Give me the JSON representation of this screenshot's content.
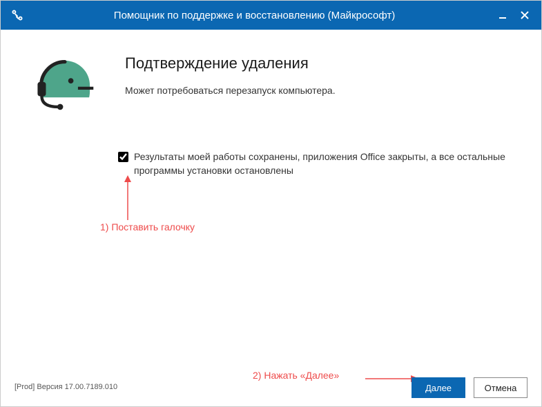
{
  "titlebar": {
    "title": "Помощник по поддержке и восстановлению (Майкрософт)"
  },
  "main": {
    "heading": "Подтверждение удаления",
    "subtext": "Может потребоваться перезапуск компьютера.",
    "checkbox_label": "Результаты моей работы сохранены, приложения Office закрыты, а все остальные программы установки остановлены"
  },
  "annotations": {
    "step1": "1) Поставить галочку",
    "step2": "2) Нажать «Далее»"
  },
  "footer": {
    "version": "[Prod] Версия 17.00.7189.010",
    "next_label": "Далее",
    "cancel_label": "Отмена"
  }
}
